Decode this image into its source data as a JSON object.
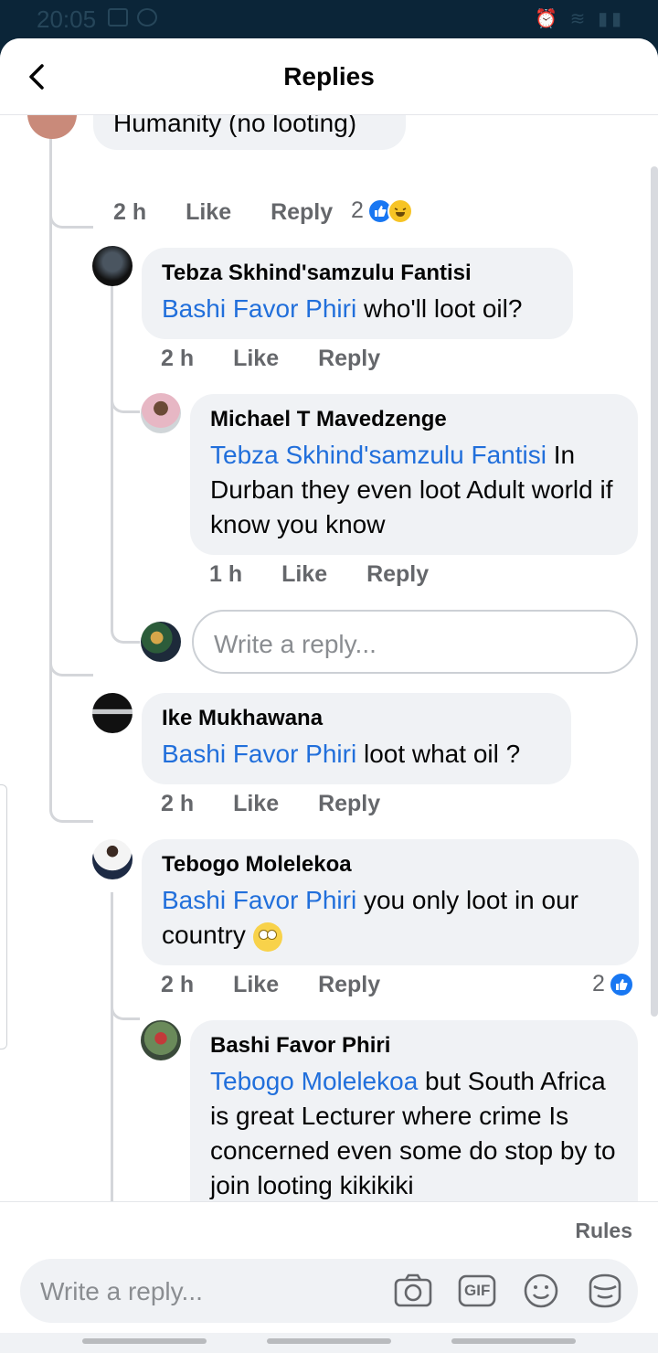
{
  "status_bar": {
    "time": "20:05"
  },
  "header": {
    "title": "Replies"
  },
  "top_comment": {
    "text_tail": "Humanity (no looting)",
    "age": "2 h",
    "like": "Like",
    "reply": "Reply",
    "reaction_count": "2"
  },
  "replies": [
    {
      "name": "Tebza Skhind'samzulu Fantisi",
      "mention": "Bashi Favor Phiri",
      "text": " who'll loot oil?",
      "age": "2 h",
      "like": "Like",
      "reply": "Reply"
    },
    {
      "name": "Michael T Mavedzenge",
      "mention": "Tebza Skhind'samzulu Fantisi",
      "text": " In Durban they even loot Adult world if know you know",
      "age": "1 h",
      "like": "Like",
      "reply": "Reply"
    },
    {
      "name": "Ike Mukhawana",
      "mention": "Bashi Favor Phiri",
      "text": " loot what oil ?",
      "age": "2 h",
      "like": "Like",
      "reply": "Reply"
    },
    {
      "name": "Tebogo Molelekoa",
      "mention": "Bashi Favor Phiri",
      "text": " you only loot in our country",
      "age": "2 h",
      "like": "Like",
      "reply": "Reply",
      "reaction_count": "2"
    },
    {
      "name": "Bashi Favor Phiri",
      "mention": "Tebogo Molelekoa",
      "text": "  but South Africa is great Lecturer where crime Is concerned even some do stop by to join looting kikikiki"
    }
  ],
  "nested_reply_box": {
    "placeholder": "Write a reply..."
  },
  "footer": {
    "rules": "Rules",
    "placeholder": "Write a reply...",
    "gif": "GIF"
  },
  "colors": {
    "mention": "#216fdb",
    "bubble": "#f0f2f5",
    "like_blue": "#1877f2"
  }
}
